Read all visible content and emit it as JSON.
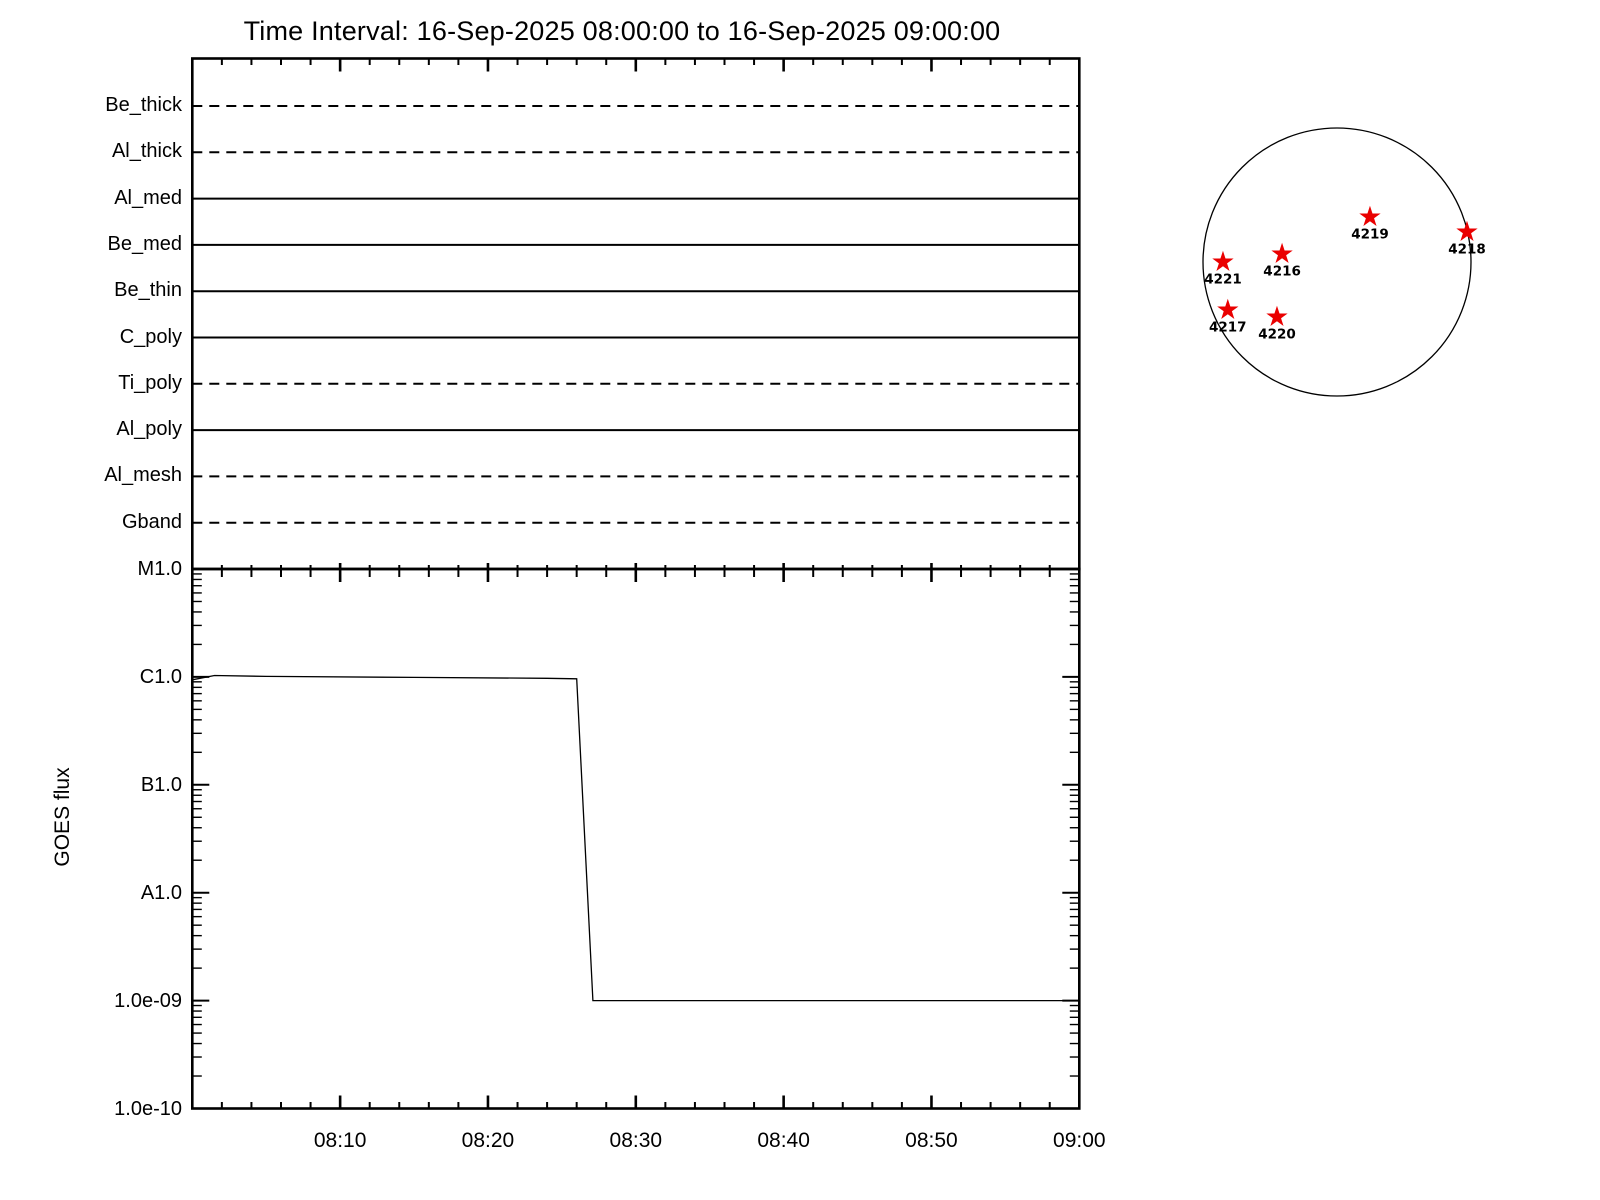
{
  "title": "Time Interval: 16-Sep-2025 08:00:00 to 16-Sep-2025 09:00:00",
  "chart_data": [
    {
      "id": "xrt_filter_timeline",
      "type": "line",
      "categories": [
        "Be_thick",
        "Al_thick",
        "Al_med",
        "Be_med",
        "Be_thin",
        "C_poly",
        "Ti_poly",
        "Al_poly",
        "Al_mesh",
        "Gband"
      ],
      "series": [
        {
          "name": "line_style",
          "values": [
            "dashed",
            "dashed",
            "solid",
            "solid",
            "solid",
            "solid",
            "dashed",
            "solid",
            "dashed",
            "dashed"
          ]
        }
      ],
      "x_range": [
        "08:00",
        "09:00"
      ],
      "x_major_tick_min": 10,
      "x_minor_tick_min": 2,
      "grid": false,
      "legend": "none"
    },
    {
      "id": "goes_flux",
      "type": "line",
      "ylabel": "GOES flux",
      "x_minutes_after_0800": [
        0,
        1.5,
        5,
        15,
        24,
        26,
        27.1,
        60
      ],
      "y_flux": [
        9.4e-07,
        1.03e-06,
        1.01e-06,
        9.9e-07,
        9.7e-07,
        9.6e-07,
        1e-09,
        1e-09
      ],
      "ylog": true,
      "ylim": [
        1e-10,
        1e-05
      ],
      "ytick_values": [
        1e-05,
        1e-06,
        1e-07,
        1e-08,
        1e-09,
        1e-10
      ],
      "ytick_labels": [
        "M1.0",
        "C1.0",
        "B1.0",
        "A1.0",
        "1.0e-09",
        "1.0e-10"
      ],
      "xtick_minutes": [
        10,
        20,
        30,
        40,
        50,
        60
      ],
      "xtick_labels": [
        "08:10",
        "08:20",
        "08:30",
        "08:40",
        "08:50",
        "09:00"
      ],
      "x_minor_tick_min": 2,
      "grid": false,
      "legend": "none"
    },
    {
      "id": "solar_disk_active_regions",
      "type": "scatter",
      "marker": "star",
      "marker_color": "#ea0000",
      "points": [
        {
          "label": "4216",
          "x": -0.41,
          "y": -0.06
        },
        {
          "label": "4217",
          "x": -0.815,
          "y": 0.358
        },
        {
          "label": "4218",
          "x": 0.97,
          "y": -0.224
        },
        {
          "label": "4219",
          "x": 0.246,
          "y": -0.336
        },
        {
          "label": "4220",
          "x": -0.448,
          "y": 0.41
        },
        {
          "label": "4221",
          "x": -0.851,
          "y": 0.0
        }
      ]
    }
  ]
}
